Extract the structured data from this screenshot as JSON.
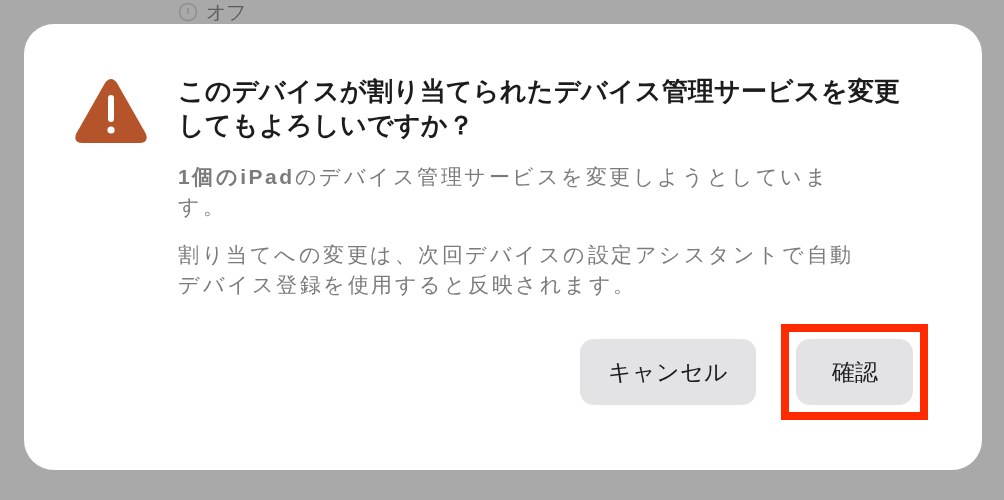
{
  "background": {
    "status_text": "オフ"
  },
  "dialog": {
    "title": "このデバイスが割り当てられたデバイス管理サービスを変更してもよろしいですか？",
    "messages": [
      "**1個のiPad**のデバイス管理サービスを変更しようとしています。",
      "割り当てへの変更は、次回デバイスの設定アシスタントで自動デバイス登録を使用すると反映されます。"
    ],
    "buttons": [
      {
        "label": "キャンセル",
        "highlighted": false
      },
      {
        "label": "確認",
        "highlighted": true
      }
    ]
  }
}
